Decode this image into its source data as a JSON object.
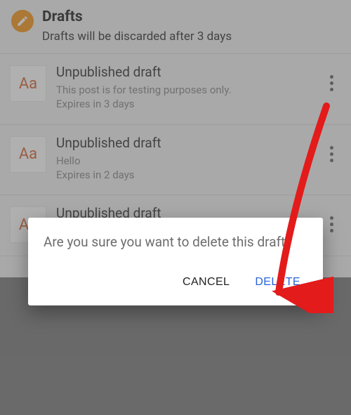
{
  "header": {
    "title": "Drafts",
    "subtitle": "Drafts will be discarded after 3 days"
  },
  "thumb_label": "Aa",
  "drafts": [
    {
      "title": "Unpublished draft",
      "snippet": "This post is for testing purposes only.",
      "expiry": "Expires in 3 days"
    },
    {
      "title": "Unpublished draft",
      "snippet": "Hello",
      "expiry": "Expires in 2 days"
    },
    {
      "title": "Unpublished draft",
      "snippet": "",
      "expiry": ""
    }
  ],
  "dialog": {
    "message": "Are you sure you want to delete this draft?",
    "cancel": "CANCEL",
    "delete": "DELETE"
  }
}
